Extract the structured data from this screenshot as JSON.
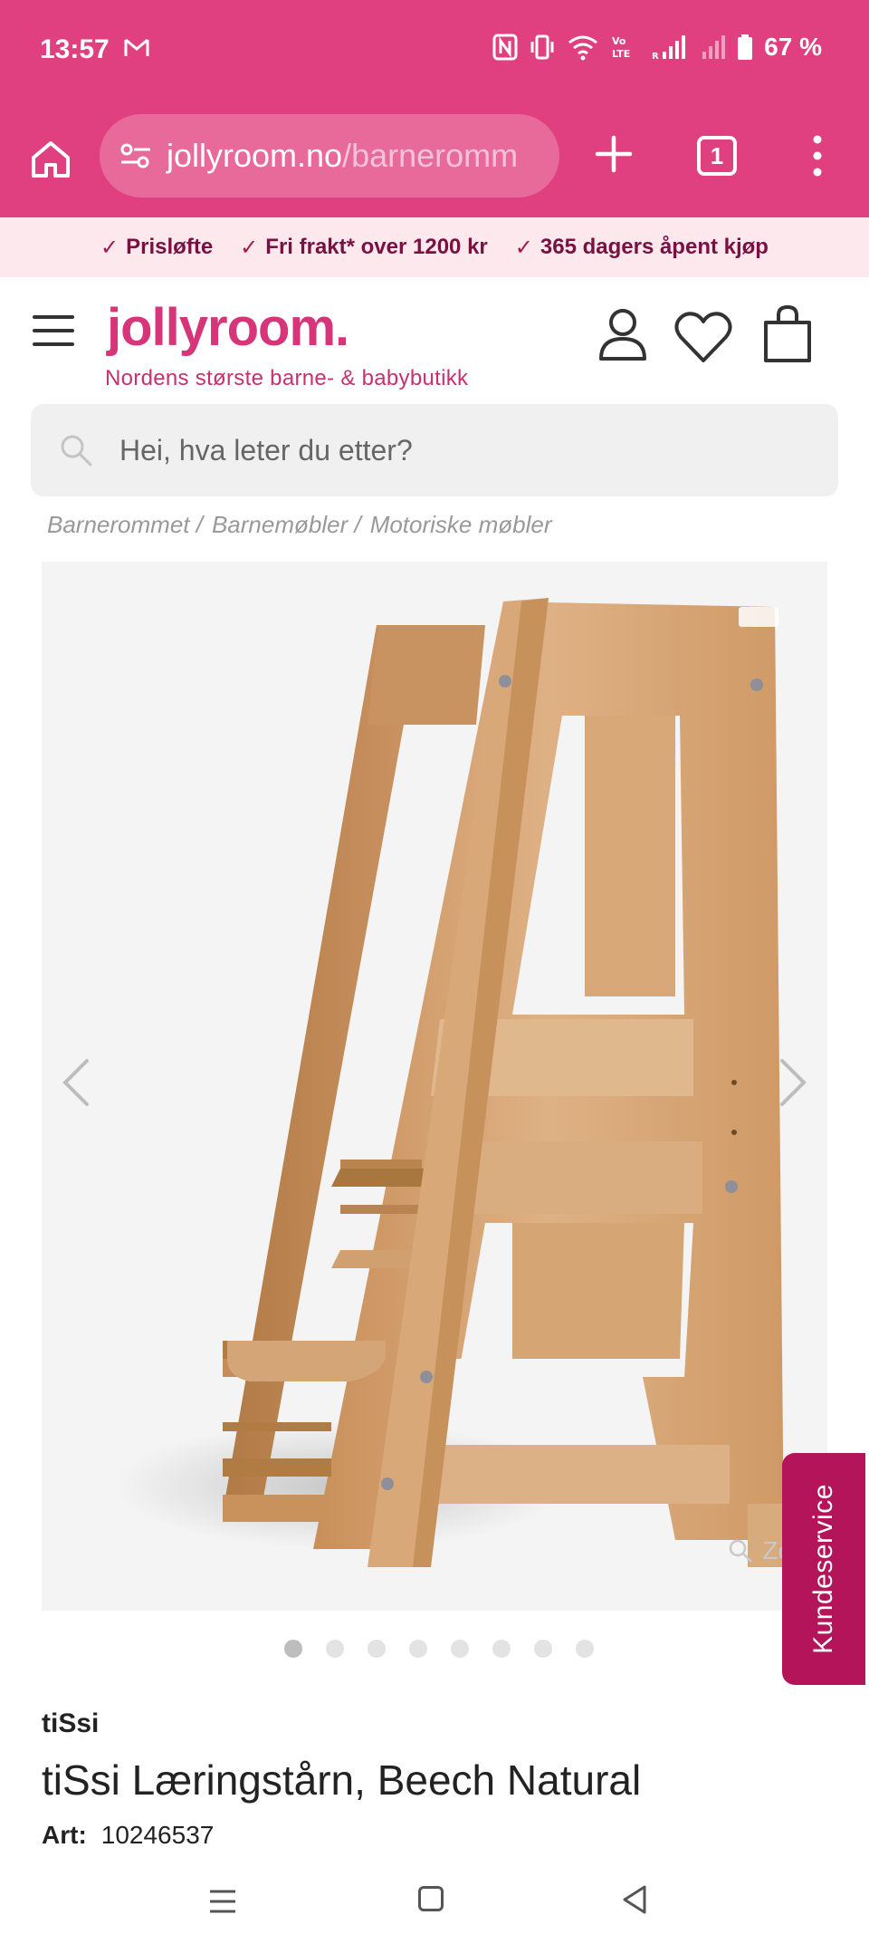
{
  "status_bar": {
    "time": "13:57",
    "battery": "67 %"
  },
  "browser": {
    "url_host": "jollyroom.no",
    "url_path": "/barneromm",
    "tab_count": "1"
  },
  "promo": {
    "items": [
      "Prisløfte",
      "Fri frakt* over 1200 kr",
      "365 dagers åpent kjøp"
    ]
  },
  "header": {
    "logo": "jollyroom.",
    "tagline": "Nordens største barne- & babybutikk"
  },
  "search": {
    "placeholder": "Hei, hva leter du etter?"
  },
  "breadcrumb": [
    "Barnerommet /",
    "Barnemøbler /",
    "Motoriske møbler"
  ],
  "gallery": {
    "zoom_label": "Zoom",
    "image_count": 8,
    "active_index": 0
  },
  "service_tab": {
    "label": "Kundeservice"
  },
  "product": {
    "brand": "tiSsi",
    "title": "tiSsi Læringstårn, Beech Natural",
    "art_label": "Art:",
    "art_number": "10246537"
  },
  "colors": {
    "brand_pink": "#e0407f",
    "logo_pink": "#d6357a",
    "service_tab": "#b3145a",
    "promo_bg": "#fde8ee"
  }
}
